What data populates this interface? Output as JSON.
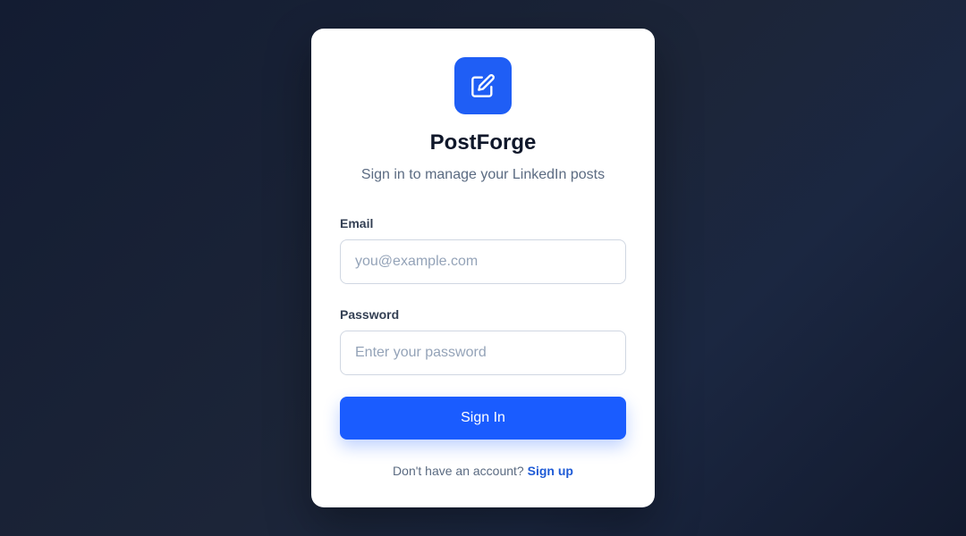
{
  "app": {
    "name": "PostForge",
    "subtitle": "Sign in to manage your LinkedIn posts",
    "logo_icon": "edit-icon",
    "accent_color": "#1a5cff"
  },
  "form": {
    "email_label": "Email",
    "email_placeholder": "you@example.com",
    "email_value": "",
    "password_label": "Password",
    "password_placeholder": "Enter your password",
    "password_value": "",
    "submit_label": "Sign In"
  },
  "footer": {
    "prompt": "Don't have an account?",
    "link_label": "Sign up"
  }
}
